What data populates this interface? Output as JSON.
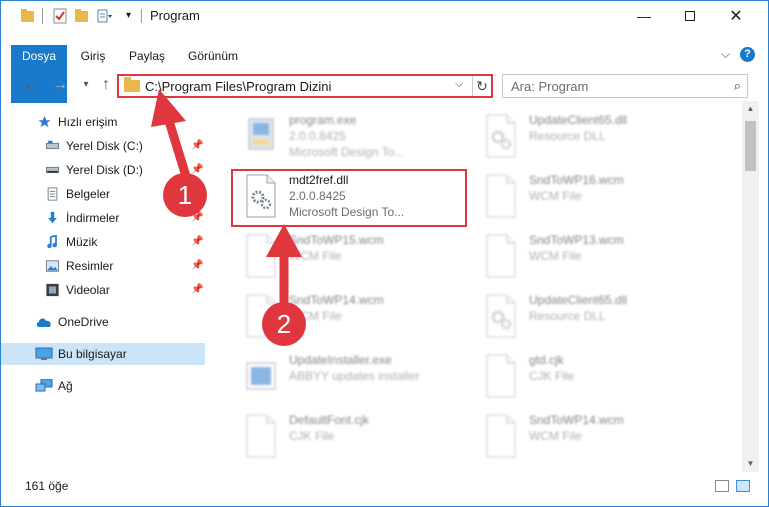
{
  "window": {
    "title": "Program"
  },
  "ribbon": {
    "tabs": [
      "Dosya",
      "Giriş",
      "Paylaş",
      "Görünüm"
    ]
  },
  "address": {
    "path": "C:\\Program Files\\Program Dizini"
  },
  "search": {
    "placeholder": "Ara: Program"
  },
  "sidebar": {
    "items": [
      {
        "label": "Hızlı erişim",
        "icon": "star-icon"
      },
      {
        "label": "Yerel Disk (C:)",
        "icon": "drive-icon"
      },
      {
        "label": "Yerel Disk (D:)",
        "icon": "drive-icon"
      },
      {
        "label": "Belgeler",
        "icon": "document-icon"
      },
      {
        "label": "İndirmeler",
        "icon": "download-icon"
      },
      {
        "label": "Müzik",
        "icon": "music-icon"
      },
      {
        "label": "Resimler",
        "icon": "pictures-icon"
      },
      {
        "label": "Videolar",
        "icon": "video-icon"
      },
      {
        "label": "OneDrive",
        "icon": "cloud-icon"
      },
      {
        "label": "Bu bilgisayar",
        "icon": "computer-icon"
      },
      {
        "label": "Ağ",
        "icon": "network-icon"
      }
    ]
  },
  "files": [
    {
      "name": "program.exe",
      "line2": "2.0.0.8425",
      "line3": "Microsoft Design To...",
      "icon": "exe-icon",
      "highlighted": false
    },
    {
      "name": "UpdateClient65.dll",
      "line2": "Resource DLL",
      "line3": "",
      "icon": "dll-icon",
      "highlighted": false
    },
    {
      "name": "mdt2fref.dll",
      "line2": "2.0.0.8425",
      "line3": "Microsoft Design To...",
      "icon": "dll-icon",
      "highlighted": true
    },
    {
      "name": "SndToWP16.wcm",
      "line2": "WCM File",
      "line3": "",
      "icon": "file-icon",
      "highlighted": false
    },
    {
      "name": "SndToWP15.wcm",
      "line2": "WCM File",
      "line3": "",
      "icon": "file-icon",
      "highlighted": false
    },
    {
      "name": "SndToWP13.wcm",
      "line2": "WCM File",
      "line3": "",
      "icon": "file-icon",
      "highlighted": false
    },
    {
      "name": "SndToWP14.wcm",
      "line2": "WCM File",
      "line3": "",
      "icon": "file-icon",
      "highlighted": false
    },
    {
      "name": "UpdateClient65.dll",
      "line2": "Resource DLL",
      "line3": "",
      "icon": "dll-icon",
      "highlighted": false
    },
    {
      "name": "UpdateInstaller.exe",
      "line2": "ABBYY updates installer",
      "line3": "",
      "icon": "installer-icon",
      "highlighted": false
    },
    {
      "name": "gtd.cjk",
      "line2": "CJK File",
      "line3": "",
      "icon": "file-icon",
      "highlighted": false
    },
    {
      "name": "DefaultFont.cjk",
      "line2": "CJK File",
      "line3": "",
      "icon": "file-icon",
      "highlighted": false
    },
    {
      "name": "SndToWP14.wcm",
      "line2": "WCM File",
      "line3": "",
      "icon": "file-icon",
      "highlighted": false
    }
  ],
  "status": {
    "count": "161 öğe"
  },
  "annotations": {
    "step1": "1",
    "step2": "2",
    "color": "#e0363d"
  },
  "colors": {
    "accent": "#1979ca",
    "highlight": "#e0363d",
    "selected": "#cce4f7"
  }
}
